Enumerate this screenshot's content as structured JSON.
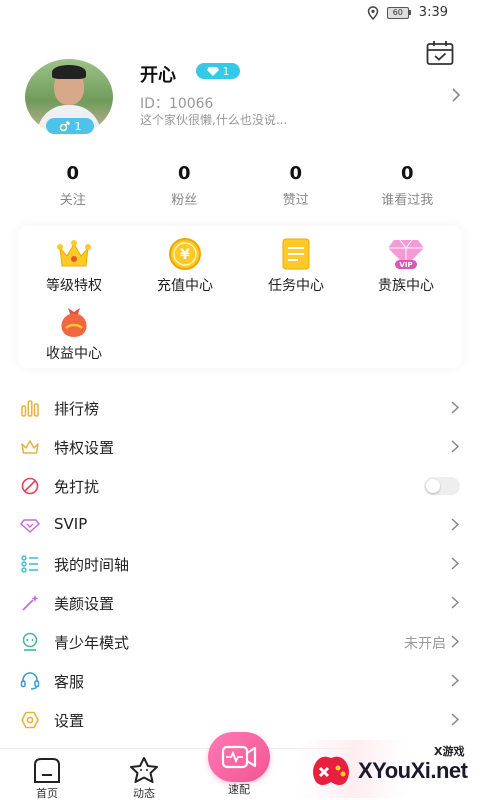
{
  "status_bar": {
    "battery": "60",
    "time": "3:39"
  },
  "profile": {
    "nickname": "开心",
    "vip_level": "1",
    "gender_level": "1",
    "user_id": "ID：10066",
    "signature": "这个家伙很懒,什么也没说..."
  },
  "stats": [
    {
      "value": "0",
      "label": "关注"
    },
    {
      "value": "0",
      "label": "粉丝"
    },
    {
      "value": "0",
      "label": "赞过"
    },
    {
      "value": "0",
      "label": "谁看过我"
    }
  ],
  "shortcuts": [
    {
      "label": "等级特权",
      "icon": "crown-icon"
    },
    {
      "label": "充值中心",
      "icon": "coin-icon"
    },
    {
      "label": "任务中心",
      "icon": "task-icon"
    },
    {
      "label": "贵族中心",
      "icon": "diamond-vip-icon"
    },
    {
      "label": "收益中心",
      "icon": "money-bag-icon"
    }
  ],
  "menu": [
    {
      "label": "排行榜",
      "icon": "ranking-icon",
      "color": "#e6b23c"
    },
    {
      "label": "特权设置",
      "icon": "privilege-crown-icon",
      "color": "#e6b23c"
    },
    {
      "label": "免打扰",
      "icon": "do-not-disturb-icon",
      "color": "#e0445a",
      "toggle": false
    },
    {
      "label": "SVIP",
      "icon": "svip-icon",
      "color": "#c46bd9"
    },
    {
      "label": "我的时间轴",
      "icon": "timeline-icon",
      "color": "#3fb8c9"
    },
    {
      "label": "美颜设置",
      "icon": "beauty-wand-icon",
      "color": "#c46bd9"
    },
    {
      "label": "青少年模式",
      "icon": "youth-mode-icon",
      "color": "#3fb8a0",
      "status": "未开启"
    },
    {
      "label": "客服",
      "icon": "customer-service-icon",
      "color": "#3a9ad9"
    },
    {
      "label": "设置",
      "icon": "settings-icon",
      "color": "#e6b23c"
    }
  ],
  "tabbar": {
    "home": "首页",
    "feed": "动态",
    "match": "速配"
  },
  "watermark": {
    "small": "X游戏",
    "big": "XYouXi.net"
  },
  "colors": {
    "accent": "#f25591",
    "vip_blue": "#35c9e8",
    "gender_blue": "#4fc2ea"
  }
}
